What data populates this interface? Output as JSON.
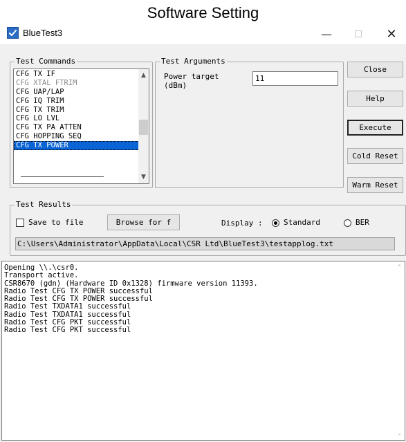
{
  "page_heading": "Software Setting",
  "window": {
    "title": "BlueTest3",
    "controls": {
      "minimize": "—",
      "close": "✕"
    }
  },
  "test_commands": {
    "label": "Test Commands",
    "items": [
      {
        "label": "CFG TX IF",
        "state": "normal"
      },
      {
        "label": "CFG XTAL FTRIM",
        "state": "dim"
      },
      {
        "label": "CFG UAP/LAP",
        "state": "normal"
      },
      {
        "label": "CFG IQ TRIM",
        "state": "normal"
      },
      {
        "label": "CFG TX TRIM",
        "state": "normal"
      },
      {
        "label": "CFG LO LVL",
        "state": "normal"
      },
      {
        "label": "CFG TX PA ATTEN",
        "state": "normal"
      },
      {
        "label": "CFG HOPPING SEQ",
        "state": "normal"
      },
      {
        "label": "CFG TX POWER",
        "state": "selected"
      }
    ]
  },
  "test_arguments": {
    "label": "Test Arguments",
    "power_target_label": "Power target\n(dBm)",
    "power_target_value": "11"
  },
  "buttons": {
    "close": "Close",
    "help": "Help",
    "execute": "Execute",
    "cold_reset": "Cold Reset",
    "warm_reset": "Warm Reset"
  },
  "test_results": {
    "label": "Test Results",
    "save_to_file_label": "Save to file",
    "save_to_file_checked": false,
    "browse_label": "Browse for f",
    "display_label": "Display :",
    "display_options": [
      "Standard",
      "BER"
    ],
    "display_selected": "Standard",
    "file_path": "C:\\Users\\Administrator\\AppData\\Local\\CSR Ltd\\BlueTest3\\testapplog.txt"
  },
  "log": [
    "Opening \\\\.\\csr0.",
    "Transport active.",
    "CSR8670 (gdn) (Hardware ID 0x1328) firmware version 11393.",
    "Radio Test CFG TX POWER successful",
    "Radio Test CFG TX POWER successful",
    "Radio Test TXDATA1 successful",
    "Radio Test TXDATA1 successful",
    "Radio Test CFG PKT successful",
    "Radio Test CFG PKT successful"
  ],
  "colors": {
    "selection": "#0a64d6",
    "window_bg": "#f0f0f0",
    "app_icon": "#2b6cc4"
  }
}
